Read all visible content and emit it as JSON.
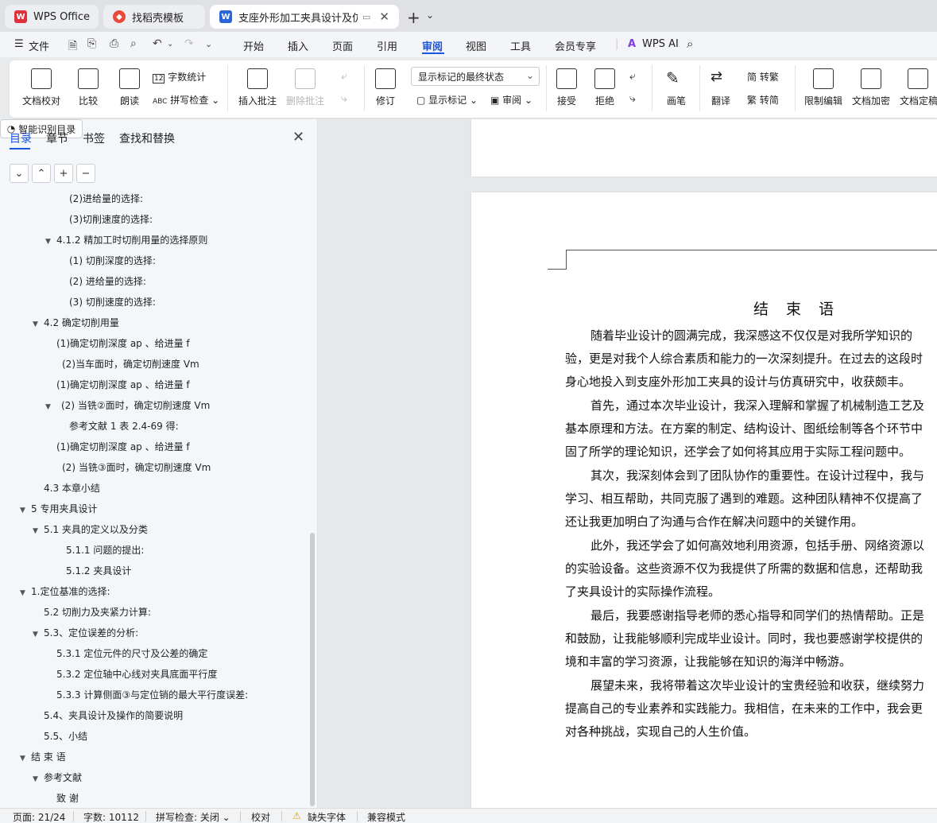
{
  "tabs": {
    "wps_office": "WPS Office",
    "templates": "找稻壳模板",
    "document": "支座外形加工夹具设计及仿真"
  },
  "menu": {
    "file": "文件",
    "start": "开始",
    "insert": "插入",
    "page": "页面",
    "reference": "引用",
    "review": "审阅",
    "view": "视图",
    "tools": "工具",
    "member": "会员专享",
    "wps_ai": "WPS AI"
  },
  "ribbon": {
    "proofread": "文档校对",
    "compare": "比较",
    "read_aloud": "朗读",
    "word_count": "字数统计",
    "spell_check": "拼写检查",
    "insert_comment": "插入批注",
    "delete_comment": "删除批注",
    "track": "修订",
    "markup_state": "显示标记的最终状态",
    "show_markup": "显示标记",
    "review_pane": "审阅",
    "accept": "接受",
    "reject": "拒绝",
    "pen": "画笔",
    "translate": "翻译",
    "to_traditional": "转繁",
    "to_simplified": "转简",
    "restrict_edit": "限制编辑",
    "encrypt": "文档加密",
    "finalize": "文档定稿"
  },
  "nav": {
    "tabs": [
      "目录",
      "章节",
      "书签",
      "查找和替换"
    ],
    "smart_toc": "智能识别目录",
    "toc": [
      "(2)进给量的选择:",
      "(3)切削速度的选择:",
      "4.1.2   精加工时切削用量的选择原则",
      "(1)  切削深度的选择:",
      "(2)  进给量的选择:",
      "(3)  切削速度的选择:",
      "4.2   确定切削用量",
      "(1)确定切削深度 ap 、给进量 f",
      "(2)当车面时，确定切削速度 Vm",
      "(1)确定切削深度 ap 、给进量 f",
      "(2)  当铣②面时，确定切削速度 Vm",
      "参考文献 1 表 2.4-69 得:",
      "(1)确定切削深度 ap 、给进量 f",
      "(2)  当铣③面时，确定切削速度 Vm",
      "4.3   本章小结",
      "5    专用夹具设计",
      "5.1  夹具的定义以及分类",
      "5.1.1  问题的提出:",
      "5.1.2    夹具设计",
      "1.定位基准的选择:",
      "5.2  切削力及夹紧力计算:",
      "5.3、定位误差的分析:",
      "5.3.1  定位元件的尺寸及公差的确定",
      "5.3.2 定位轴中心线对夹具底面平行度",
      "5.3.3  计算侧面③与定位销的最大平行度误差:",
      "5.4、夹具设计及操作的简要说明",
      "5.5、小结",
      "结  束  语",
      "参考文献",
      "致  谢"
    ]
  },
  "document": {
    "title": "结 束 语",
    "lines": [
      "随着毕业设计的圆满完成，我深感这不仅仅是对我所学知识的",
      "验，更是对我个人综合素质和能力的一次深刻提升。在过去的这段时",
      "身心地投入到支座外形加工夹具的设计与仿真研究中，收获颇丰。",
      "首先，通过本次毕业设计，我深入理解和掌握了机械制造工艺及",
      "基本原理和方法。在方案的制定、结构设计、图纸绘制等各个环节中",
      "固了所学的理论知识，还学会了如何将其应用于实际工程问题中。",
      "其次，我深刻体会到了团队协作的重要性。在设计过程中，我与",
      "学习、相互帮助，共同克服了遇到的难题。这种团队精神不仅提高了",
      "还让我更加明白了沟通与合作在解决问题中的关键作用。",
      "此外，我还学会了如何高效地利用资源，包括手册、网络资源以",
      "的实验设备。这些资源不仅为我提供了所需的数据和信息，还帮助我",
      "了夹具设计的实际操作流程。",
      "最后，我要感谢指导老师的悉心指导和同学们的热情帮助。正是",
      "和鼓励，让我能够顺利完成毕业设计。同时，我也要感谢学校提供的",
      "境和丰富的学习资源，让我能够在知识的海洋中畅游。",
      "展望未来，我将带着这次毕业设计的宝贵经验和收获，继续努力",
      "提高自己的专业素养和实践能力。我相信，在未来的工作中，我会更",
      "对各种挑战，实现自己的人生价值。"
    ]
  },
  "status": {
    "page": "页面: 21/24",
    "words": "字数: 10112",
    "spell": "拼写检查: 关闭",
    "proof": "校对",
    "missing_font": "缺失字体",
    "compat": "兼容模式"
  },
  "colors": {
    "accent": "#1a56db",
    "wps_red": "#e0303a"
  }
}
